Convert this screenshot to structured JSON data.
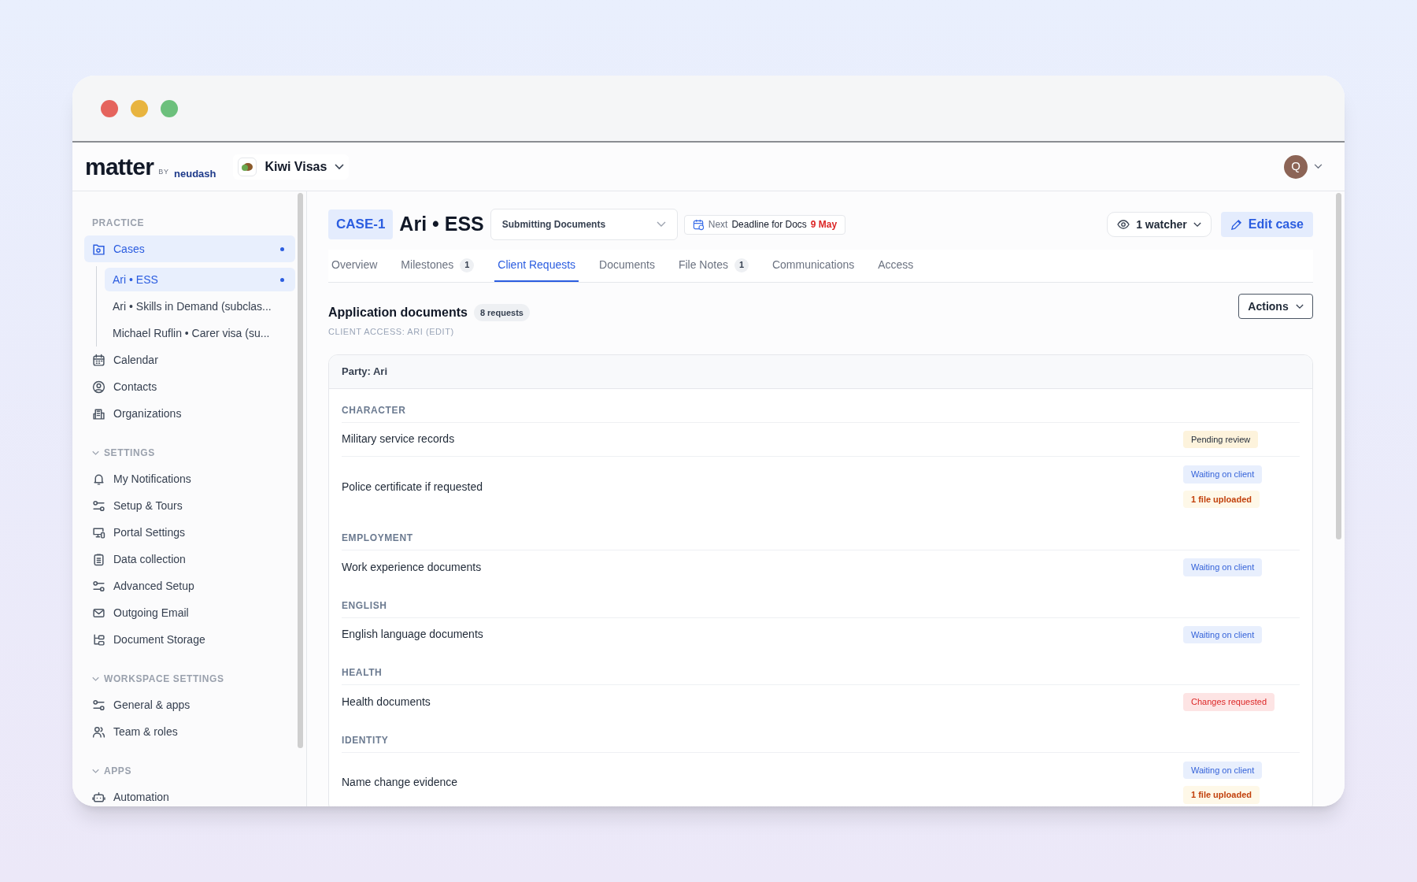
{
  "header": {
    "logo": {
      "word": "matter",
      "by": "BY",
      "maker": "neudash"
    },
    "workspace": "Kiwi Visas",
    "avatar": "Q"
  },
  "sidebar": {
    "sections": [
      {
        "heading": "PRACTICE",
        "items": [
          {
            "label": "Cases",
            "selected": true,
            "children": [
              {
                "label": "Ari • ESS",
                "selected": true
              },
              {
                "label": "Ari • Skills in Demand (subclas...",
                "selected": false
              },
              {
                "label": "Michael Ruflin • Carer visa (su...",
                "selected": false
              }
            ]
          },
          {
            "label": "Calendar",
            "selected": false
          },
          {
            "label": "Contacts",
            "selected": false
          },
          {
            "label": "Organizations",
            "selected": false
          }
        ]
      },
      {
        "heading": "SETTINGS",
        "expanded": true,
        "items": [
          {
            "label": "My Notifications",
            "selected": false
          },
          {
            "label": "Setup & Tours",
            "selected": false
          },
          {
            "label": "Portal Settings",
            "selected": false
          },
          {
            "label": "Data collection",
            "selected": false
          },
          {
            "label": "Advanced Setup",
            "selected": false
          },
          {
            "label": "Outgoing Email",
            "selected": false
          },
          {
            "label": "Document Storage",
            "selected": false
          }
        ]
      },
      {
        "heading": "WORKSPACE SETTINGS",
        "expanded": true,
        "items": [
          {
            "label": "General & apps",
            "selected": false
          },
          {
            "label": "Team & roles",
            "selected": false
          }
        ]
      },
      {
        "heading": "APPS",
        "expanded": true,
        "items": [
          {
            "label": "Automation",
            "selected": false
          }
        ]
      }
    ]
  },
  "case": {
    "id": "CASE-1",
    "title": "Ari • ESS",
    "status": "Submitting Documents",
    "deadline": {
      "prefix": "Next",
      "label": "Deadline for Docs",
      "date": "9 May"
    },
    "watchers": "1 watcher",
    "edit": "Edit case"
  },
  "tabs": [
    {
      "label": "Overview",
      "selected": false
    },
    {
      "label": "Milestones",
      "count": "1",
      "selected": false
    },
    {
      "label": "Client Requests",
      "selected": true
    },
    {
      "label": "Documents",
      "selected": false
    },
    {
      "label": "File Notes",
      "count": "1",
      "selected": false
    },
    {
      "label": "Communications",
      "selected": false
    },
    {
      "label": "Access",
      "selected": false
    }
  ],
  "requests": {
    "title": "Application documents",
    "count": "8 requests",
    "access": "CLIENT ACCESS: ARI (EDIT)",
    "actions": "Actions",
    "party": "Party: Ari",
    "groups": [
      {
        "heading": "CHARACTER",
        "rows": [
          {
            "label": "Military service records",
            "badges": [
              {
                "text": "Pending review",
                "kind": "pending"
              }
            ]
          },
          {
            "label": "Police certificate if requested",
            "badges": [
              {
                "text": "Waiting on client",
                "kind": "waiting"
              },
              {
                "text": "1 file uploaded",
                "kind": "uploaded"
              }
            ]
          }
        ]
      },
      {
        "heading": "EMPLOYMENT",
        "rows": [
          {
            "label": "Work experience documents",
            "badges": [
              {
                "text": "Waiting on client",
                "kind": "waiting"
              }
            ]
          }
        ]
      },
      {
        "heading": "ENGLISH",
        "rows": [
          {
            "label": "English language documents",
            "badges": [
              {
                "text": "Waiting on client",
                "kind": "waiting"
              }
            ]
          }
        ]
      },
      {
        "heading": "HEALTH",
        "rows": [
          {
            "label": "Health documents",
            "badges": [
              {
                "text": "Changes requested",
                "kind": "changes"
              }
            ]
          }
        ]
      },
      {
        "heading": "IDENTITY",
        "rows": [
          {
            "label": "Name change evidence",
            "badges": [
              {
                "text": "Waiting on client",
                "kind": "waiting"
              },
              {
                "text": "1 file uploaded",
                "kind": "uploaded"
              }
            ]
          }
        ]
      }
    ]
  }
}
